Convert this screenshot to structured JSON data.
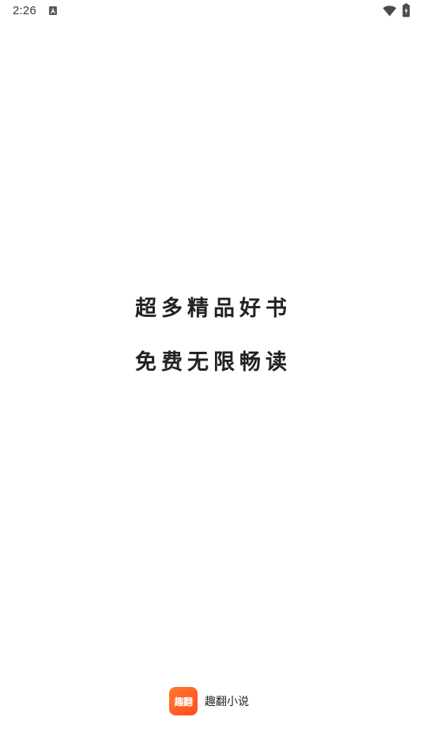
{
  "status_bar": {
    "time": "2:26",
    "icons": [
      "notification-a-icon",
      "wifi-icon",
      "battery-charging-icon"
    ]
  },
  "slogan": {
    "line1": "超多精品好书",
    "line2": "免费无限畅读"
  },
  "brand": {
    "logo_text": "趣翻",
    "app_name": "趣翻小说",
    "logo_color": "#ff5a22"
  }
}
